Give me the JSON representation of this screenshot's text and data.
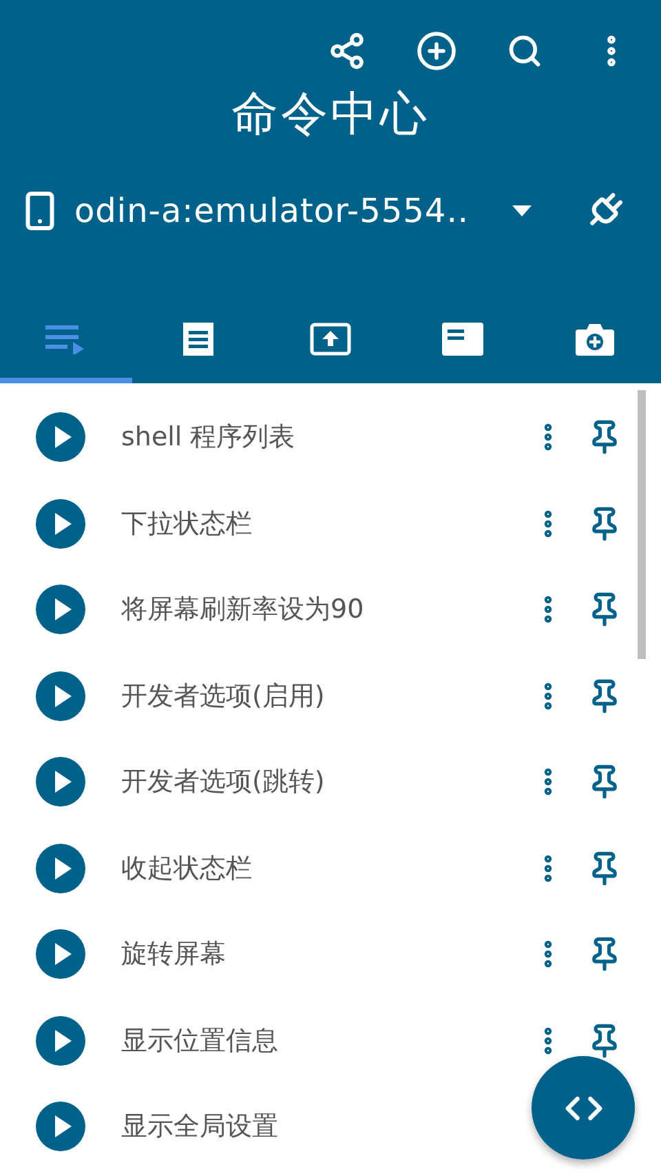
{
  "title": "命令中心",
  "device": {
    "name": "odin-a:emulator-5554‥"
  },
  "tabs": [
    {
      "kind": "queue",
      "selected": true
    },
    {
      "kind": "receipt",
      "selected": false
    },
    {
      "kind": "upload",
      "selected": false
    },
    {
      "kind": "card",
      "selected": false
    },
    {
      "kind": "camera",
      "selected": false
    }
  ],
  "commands": [
    {
      "label": "shell 程序列表"
    },
    {
      "label": "下拉状态栏"
    },
    {
      "label": "将屏幕刷新率设为90"
    },
    {
      "label": "开发者选项(启用)"
    },
    {
      "label": "开发者选项(跳转)"
    },
    {
      "label": "收起状态栏"
    },
    {
      "label": "旋转屏幕"
    },
    {
      "label": "显示位置信息"
    },
    {
      "label": "显示全局设置"
    }
  ]
}
